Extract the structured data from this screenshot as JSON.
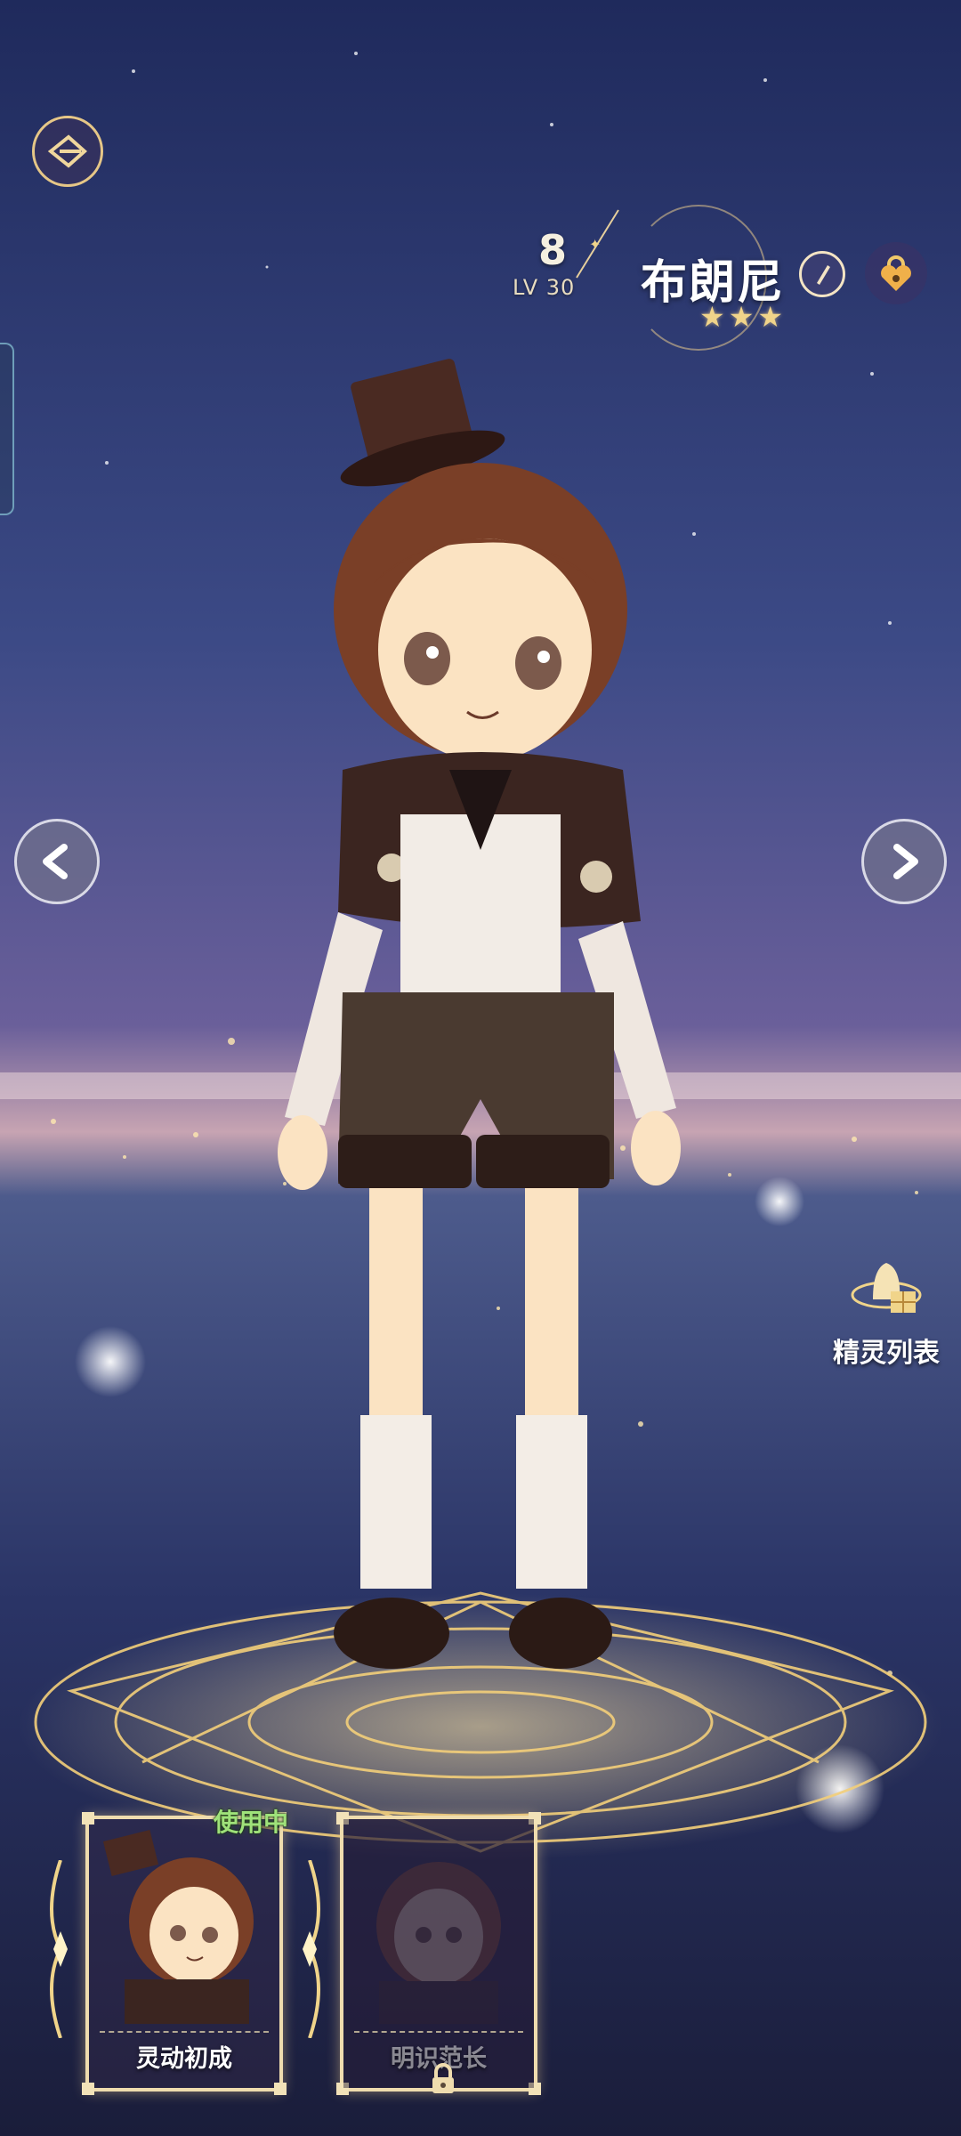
{
  "header": {
    "level": "8",
    "max_level": "LV 30",
    "character_name": "布朗尼",
    "star_count": 3,
    "star_symbol": "★"
  },
  "spirit_list": {
    "label": "精灵列表"
  },
  "skins": {
    "in_use_label": "使用中",
    "cards": [
      {
        "title": "灵动初成",
        "locked": false
      },
      {
        "title": "明识范长",
        "locked": true
      }
    ]
  },
  "colors": {
    "accent_gold": "#efdcae",
    "in_use_green": "#9fe27a",
    "star_gold": "#f0d48a"
  },
  "icons": {
    "back": "back-emblem-icon",
    "edit": "edit-pen-icon",
    "lock": "heart-lock-icon",
    "prev": "chevron-left-icon",
    "next": "chevron-right-icon",
    "spirit_list": "spirit-list-icon",
    "card_lock": "lock-icon"
  }
}
